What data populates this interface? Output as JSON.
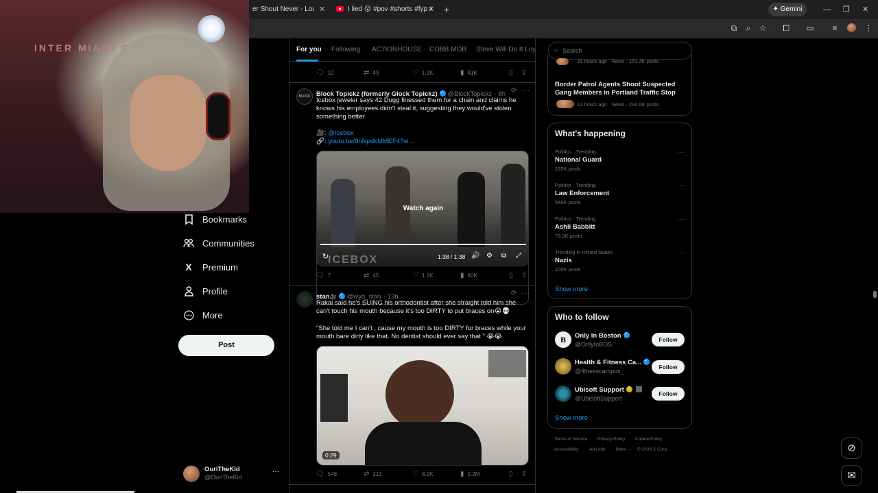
{
  "browser": {
    "tabs": [
      {
        "label": "er Shout Never - Lousy Trut"
      },
      {
        "label": "I lied 😮 #pov #shorts #fyp #s"
      }
    ],
    "new_tab": "+",
    "gemini_label": "Gemini",
    "window_controls": {
      "minimize": "—",
      "maximize": "❐",
      "close": "✕"
    }
  },
  "sidebar": {
    "items": [
      {
        "label": "Bookmarks",
        "icon": "bookmark-icon"
      },
      {
        "label": "Communities",
        "icon": "communities-icon"
      },
      {
        "label": "Premium",
        "icon": "x-logo-icon"
      },
      {
        "label": "Profile",
        "icon": "profile-icon"
      },
      {
        "label": "More",
        "icon": "more-circle-icon"
      }
    ],
    "post_label": "Post",
    "account": {
      "name": "OuriTheKid",
      "handle": "@OuriTheKid",
      "menu": "···"
    }
  },
  "feed": {
    "tabs": [
      "For you",
      "Following",
      "AC7IONHOUSE",
      "COBB MOB",
      "Steve Will Do It Loyal"
    ],
    "prev_actions": {
      "replies": "12",
      "reposts": "49",
      "likes": "1.1K",
      "views": "41K"
    },
    "tweets": [
      {
        "name": "Block Topickz (formerly Glock Topickz)",
        "handle": "@BlockTopickz",
        "time": "· 8h",
        "text": "Icebox jeweler says 42 Dugg finessed them for a chain and claims he knows his employees didn't steal it, suggesting they would've stolen something better",
        "link1_prefix": "🎥: ",
        "link1": "@Icebox",
        "link2_prefix": "🔗: ",
        "link2": "youtu.be/9nNpdkMMEF4?si...",
        "video": {
          "overlay": "Watch again",
          "time": "1:38 / 1:38",
          "watermark": "ICEBOX",
          "progress": 1.0
        },
        "actions": {
          "replies": "7",
          "reposts": "45",
          "likes": "1.1K",
          "views": "90K"
        }
      },
      {
        "name": "stan",
        "name_emoji": "🎥",
        "handle": "@wyd_stan",
        "time": "· 13h",
        "text": "Rakai said he's SUING his orthodontist after  she straight told him she can't touch his mouth because it's too DIRTY to put braces on😭💀",
        "quote": "\"She told me I can't , cause my mouth is too DIRTY for braces while your mouth bare dirty like that. No dentist should ever say that \" 😭😭",
        "video": {
          "duration": "0:29"
        },
        "actions": {
          "replies": "548",
          "reposts": "213",
          "likes": "8.2K",
          "views": "2.2M"
        }
      }
    ]
  },
  "right": {
    "search_placeholder": "Search",
    "news_top": {
      "meta": "19 hours ago · News · 151.4K posts"
    },
    "news": {
      "title": "Border Patrol Agents Shoot Suspected Gang Members in Portland Traffic Stop",
      "meta": "12 hours ago · News · 234.5K posts"
    },
    "happening": {
      "title": "What's happening",
      "trends": [
        {
          "meta": "Politics · Trending",
          "name": "National Guard",
          "count": "135K posts"
        },
        {
          "meta": "Politics · Trending",
          "name": "Law Enforcement",
          "count": "546K posts"
        },
        {
          "meta": "Politics · Trending",
          "name": "Ashli Babbitt",
          "count": "78.2K posts"
        },
        {
          "meta": "Trending in United States",
          "name": "Nazis",
          "count": "105K posts"
        }
      ],
      "show_more": "Show more"
    },
    "who_to_follow": {
      "title": "Who to follow",
      "accounts": [
        {
          "name": "Only In Boston",
          "handle": "@OnlyInBOS",
          "badge": "blue"
        },
        {
          "name": "Health & Fitness Ca...",
          "handle": "@fitnesscampus_",
          "badge": "blue"
        },
        {
          "name": "Ubisoft Support",
          "handle": "@UbisoftSupport",
          "badge": "gold"
        }
      ],
      "follow_label": "Follow",
      "show_more": "Show more"
    },
    "footer": [
      "Terms of Service",
      "Privacy Policy",
      "Cookie Policy",
      "Accessibility",
      "Ads info",
      "More ···",
      "© 2026 X Corp."
    ]
  },
  "webcam": {
    "banner": "INTER MIAMI C"
  }
}
